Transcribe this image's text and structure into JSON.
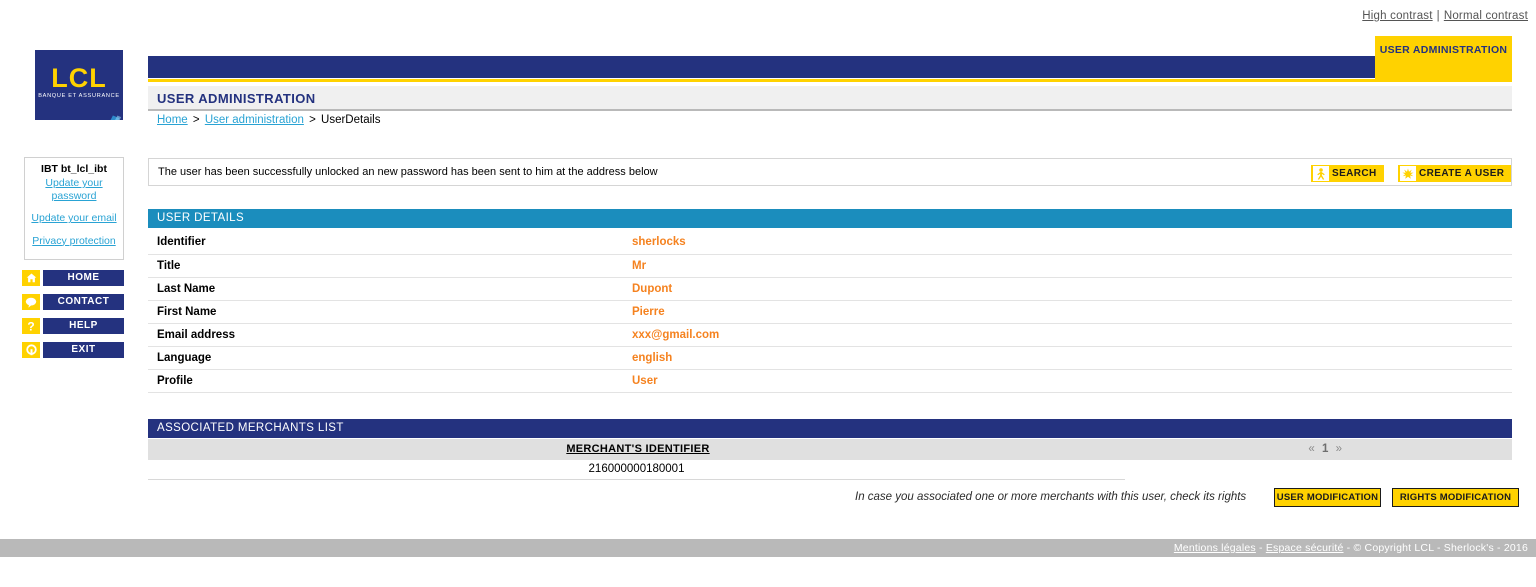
{
  "topbar": {
    "high_contrast": "High contrast",
    "separator": "|",
    "normal_contrast": "Normal contrast"
  },
  "logo": {
    "text": "LCL",
    "tagline": "BANQUE ET ASSURANCE"
  },
  "header": {
    "tab_label": "USER ADMINISTRATION",
    "page_title": "USER ADMINISTRATION"
  },
  "breadcrumb": {
    "home": "Home",
    "sep1": ">",
    "section": "User administration",
    "sep2": ">",
    "current": "UserDetails"
  },
  "user_box": {
    "identity": "IBT bt_lcl_ibt",
    "update_password": "Update your password",
    "update_email": "Update your email",
    "privacy": "Privacy protection"
  },
  "nav": {
    "items": [
      {
        "label": "HOME",
        "icon": "home-icon"
      },
      {
        "label": "CONTACT",
        "icon": "speech-bubble-icon"
      },
      {
        "label": "HELP",
        "icon": "question-mark-icon"
      },
      {
        "label": "EXIT",
        "icon": "power-exit-icon"
      }
    ]
  },
  "message": {
    "text": "The user has been successfully unlocked an new password has been sent to him at the address below"
  },
  "actions": {
    "search_label": "SEARCH",
    "search_icon": "person-icon",
    "create_label": "CREATE A USER",
    "create_icon": "sparkle-icon"
  },
  "user_details": {
    "section_title": "USER DETAILS",
    "rows": [
      {
        "label": "Identifier",
        "value": "sherlocks"
      },
      {
        "label": "Title",
        "value": "Mr"
      },
      {
        "label": "Last Name",
        "value": "Dupont"
      },
      {
        "label": "First Name",
        "value": "Pierre"
      },
      {
        "label": "Email address",
        "value": "xxx@gmail.com"
      },
      {
        "label": "Language",
        "value": "english"
      },
      {
        "label": "Profile",
        "value": "User"
      }
    ]
  },
  "merchants": {
    "section_title": "ASSOCIATED MERCHANTS LIST",
    "column_header": "MERCHANT'S IDENTIFIER",
    "rows": [
      "216000000180001"
    ],
    "pager": {
      "prev": "«",
      "page": "1",
      "next": "»"
    }
  },
  "footer_actions": {
    "note": "In case you associated one or more merchants with this user, check its rights",
    "user_modification": "USER MODIFICATION",
    "rights_modification": "RIGHTS MODIFICATION"
  },
  "footer": {
    "legal": "Mentions légales",
    "dash1": "-",
    "security": "Espace sécurité",
    "dash2": "-",
    "copyright": "© Copyright LCL - Sherlock's - 2016"
  },
  "colors": {
    "navy": "#24327f",
    "yellow": "#ffd200",
    "teal": "#1b8dbd",
    "orange": "#f5821f",
    "link_blue": "#29a3d4",
    "footer_gray": "#b9b9b9"
  }
}
